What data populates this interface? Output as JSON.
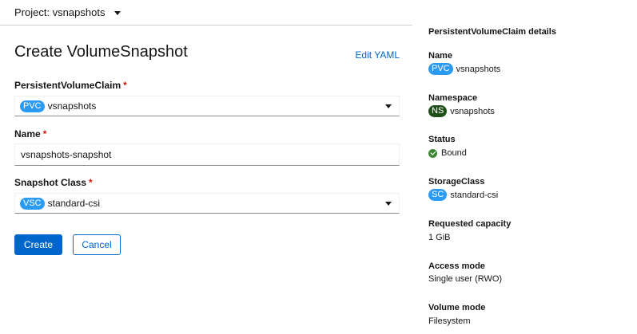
{
  "project": {
    "label": "Project: vsnapshots"
  },
  "form": {
    "title": "Create VolumeSnapshot",
    "edit_yaml": "Edit YAML",
    "pvc": {
      "label": "PersistentVolumeClaim",
      "required": "*",
      "badge": "PVC",
      "value": "vsnapshots"
    },
    "name": {
      "label": "Name",
      "required": "*",
      "value": "vsnapshots-snapshot"
    },
    "snapshot_class": {
      "label": "Snapshot Class",
      "required": "*",
      "badge": "VSC",
      "value": "standard-csi"
    },
    "create_button": "Create",
    "cancel_button": "Cancel"
  },
  "details": {
    "title": "PersistentVolumeClaim details",
    "name_label": "Name",
    "name_badge": "PVC",
    "name_value": "vsnapshots",
    "namespace_label": "Namespace",
    "namespace_badge": "NS",
    "namespace_value": "vsnapshots",
    "status_label": "Status",
    "status_value": "Bound",
    "storage_class_label": "StorageClass",
    "storage_class_badge": "SC",
    "storage_class_value": "standard-csi",
    "capacity_label": "Requested capacity",
    "capacity_value": "1 GiB",
    "access_mode_label": "Access mode",
    "access_mode_value": "Single user (RWO)",
    "volume_mode_label": "Volume mode",
    "volume_mode_value": "Filesystem"
  },
  "colors": {
    "primary": "#0066cc",
    "required": "#c9190b",
    "badge_blue": "#2b9af3",
    "badge_ns": "#1e4f18",
    "status_ok": "#3e8635"
  },
  "icons": {
    "project_dropdown": "caret-down-icon",
    "select_dropdown": "caret-down-icon",
    "status": "check-circle-icon"
  }
}
